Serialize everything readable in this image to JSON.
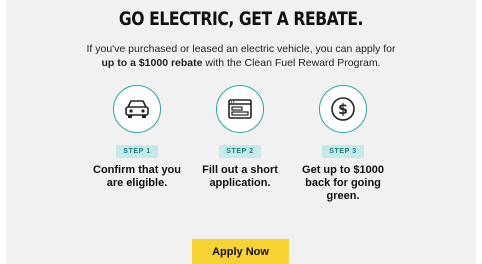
{
  "title": "GO ELECTRIC, GET A REBATE.",
  "intro": {
    "line1": "If you've purchased or leased an electric vehicle, you can apply for",
    "line2_bold": "up to a $1000 rebate",
    "line2_rest": " with the Clean Fuel Reward Program."
  },
  "steps": [
    {
      "badge": "STEP 1",
      "text_line1": "Confirm that you",
      "text_line2": "are eligible.",
      "text_line3": "",
      "icon": "car-icon"
    },
    {
      "badge": "STEP 2",
      "text_line1": "Fill out a short",
      "text_line2": "application.",
      "text_line3": "",
      "icon": "form-window-icon"
    },
    {
      "badge": "STEP 3",
      "text_line1": "Get up to $1000",
      "text_line2": "back for going",
      "text_line3": "green.",
      "icon": "dollar-coin-icon"
    }
  ],
  "cta": {
    "label": "Apply Now"
  },
  "colors": {
    "accent_teal": "#2aa6a3",
    "badge_bg": "#c4eaea",
    "button_yellow": "#f7d332",
    "panel_bg": "#f1f1f1"
  }
}
